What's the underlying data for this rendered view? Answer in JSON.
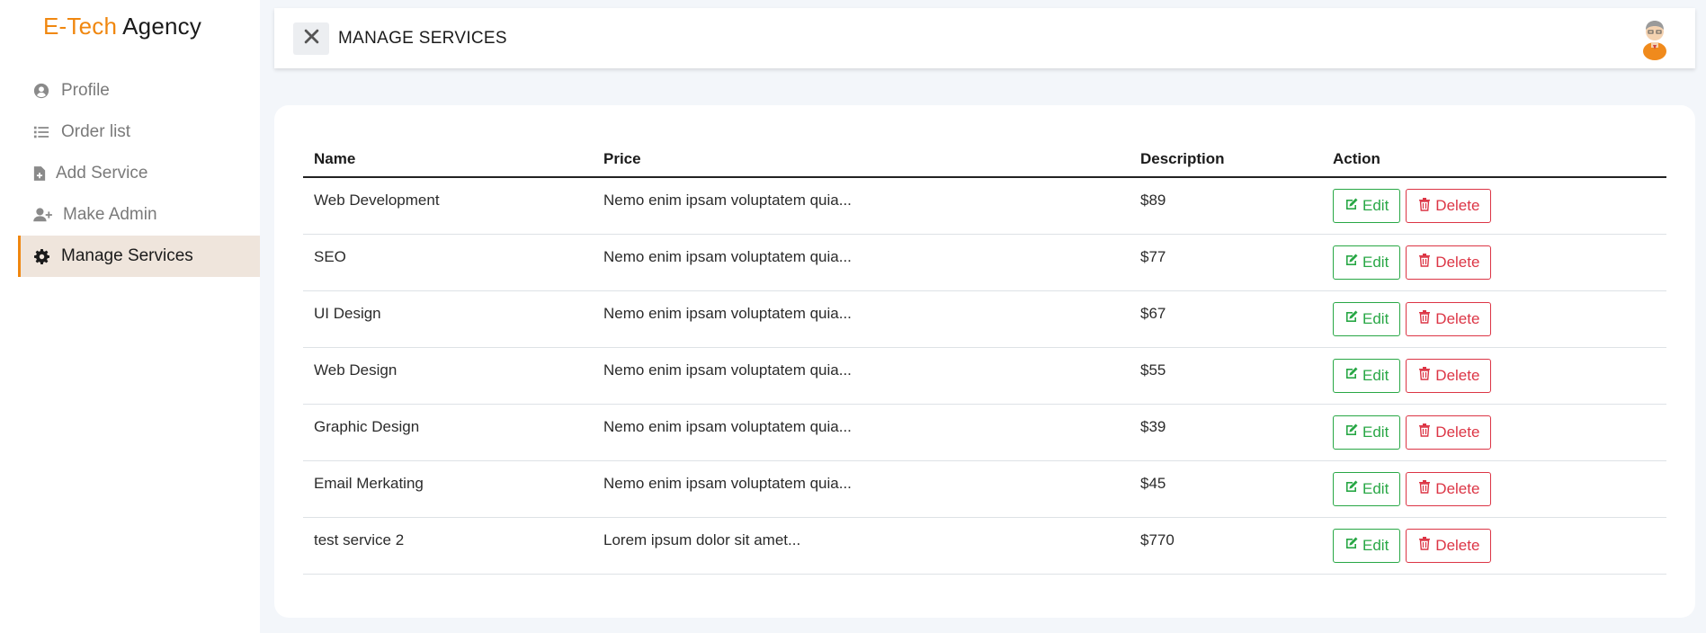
{
  "brand": {
    "part1": "E-Tech",
    "part2": " Agency",
    "accent_color": "#f0870f"
  },
  "sidebar": {
    "items": [
      {
        "label": "Profile",
        "icon": "user-circle-icon"
      },
      {
        "label": "Order list",
        "icon": "list-icon"
      },
      {
        "label": "Add Service",
        "icon": "file-plus-icon"
      },
      {
        "label": "Make Admin",
        "icon": "user-plus-icon"
      },
      {
        "label": "Manage Services",
        "icon": "gear-icon",
        "active": true
      }
    ]
  },
  "header": {
    "title": "MANAGE SERVICES"
  },
  "table": {
    "columns": [
      "Name",
      "Price",
      "Description",
      "Action"
    ],
    "rows": [
      {
        "name": "Web Development",
        "price": "Nemo enim ipsam voluptatem quia...",
        "description": "$89"
      },
      {
        "name": "SEO",
        "price": "Nemo enim ipsam voluptatem quia...",
        "description": "$77"
      },
      {
        "name": "UI Design",
        "price": "Nemo enim ipsam voluptatem quia...",
        "description": "$67"
      },
      {
        "name": "Web Design",
        "price": "Nemo enim ipsam voluptatem quia...",
        "description": "$55"
      },
      {
        "name": "Graphic Design",
        "price": "Nemo enim ipsam voluptatem quia...",
        "description": "$39"
      },
      {
        "name": "Email Merkating",
        "price": "Nemo enim ipsam voluptatem quia...",
        "description": "$45"
      },
      {
        "name": "test service 2",
        "price": "Lorem ipsum dolor sit amet...",
        "description": "$770"
      }
    ],
    "edit_label": "Edit",
    "delete_label": "Delete"
  },
  "colors": {
    "edit": "#28a745",
    "delete": "#dc3545",
    "active_bg": "#efe5dc"
  }
}
